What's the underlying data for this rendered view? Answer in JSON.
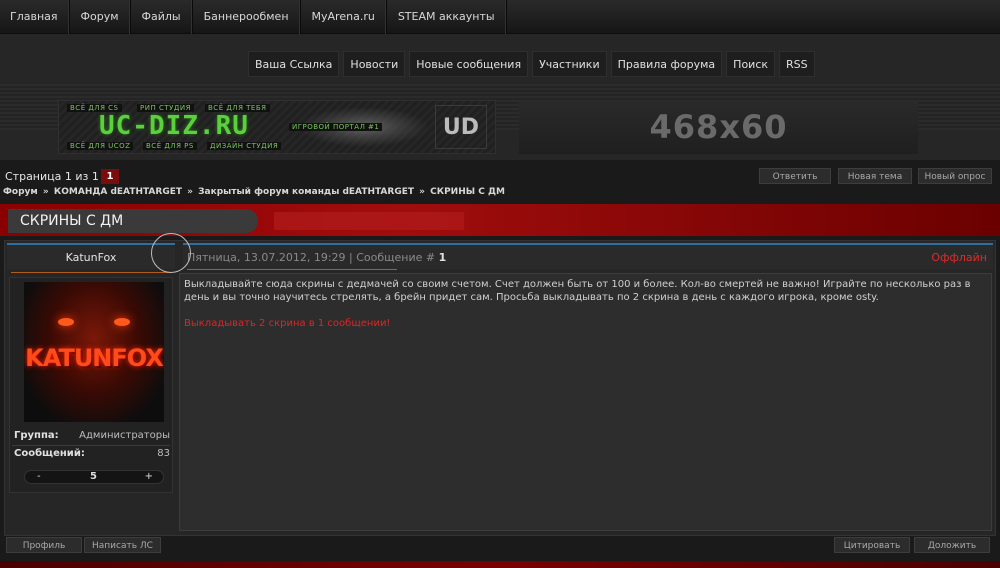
{
  "topnav": [
    "Главная",
    "Форум",
    "Файлы",
    "Баннерообмен",
    "MyArena.ru",
    "STEAM аккаунты"
  ],
  "secnav": [
    "Ваша Ссылка",
    "Новости",
    "Новые сообщения",
    "Участники",
    "Правила форума",
    "Поиск",
    "RSS"
  ],
  "banner1": {
    "logo": "UC-DIZ.RU",
    "tags": [
      "ВСЁ ДЛЯ CS",
      "РИП СТУДИЯ",
      "ВСЁ ДЛЯ ТЕБЯ",
      "ИГРОВОЙ ПОРТАЛ #1",
      "ВСЁ ДЛЯ UCOZ",
      "ВСЁ ДЛЯ PS",
      "ДИЗАЙН СТУДИЯ"
    ],
    "mark": "UD"
  },
  "banner2": {
    "text": "468x60"
  },
  "pagination": {
    "label": "Страница 1 из 1",
    "current": "1"
  },
  "actions": {
    "reply": "Ответить",
    "new_topic": "Новая тема",
    "new_poll": "Новый опрос"
  },
  "breadcrumb": [
    "Форум",
    "КОМАНДА dEATHTARGET",
    "Закрытый форум команды dEATHTARGET",
    "СКРИНЫ С ДМ"
  ],
  "breadcrumb_sep": "»",
  "topic_title": "СКРИНЫ С ДМ",
  "post": {
    "author": "KatunFox",
    "avatar_text": "KATUNFOX",
    "date_text": "Пятница, 13.07.2012, 19:29 | Сообщение #",
    "number": "1",
    "status": "Оффлайн",
    "group_label": "Группа:",
    "group_value": "Администраторы",
    "messages_label": "Сообщений:",
    "messages_value": "83",
    "rep_minus": "-",
    "rep_value": "5",
    "rep_plus": "+",
    "body": "Выкладывайте сюда скрины с дедмачей со своим счетом. Счет должен быть от 100 и более. Кол-во смертей не важно! Играйте по несколько раз в день и вы точно научитесь стрелять, а брейн придет сам. Просьба выкладывать по 2 скрина в день с каждого игрока, кроме osty.",
    "body_red": "Выкладывать 2 скрина в 1 сообщении!"
  },
  "bottom": {
    "profile": "Профиль",
    "pm": "Написать ЛС",
    "quote": "Цитировать",
    "complain": "Доложить"
  },
  "colors": {
    "accent_red": "#8a0000",
    "offline": "#e02a2a",
    "link_blue": "#2c6fa0"
  }
}
